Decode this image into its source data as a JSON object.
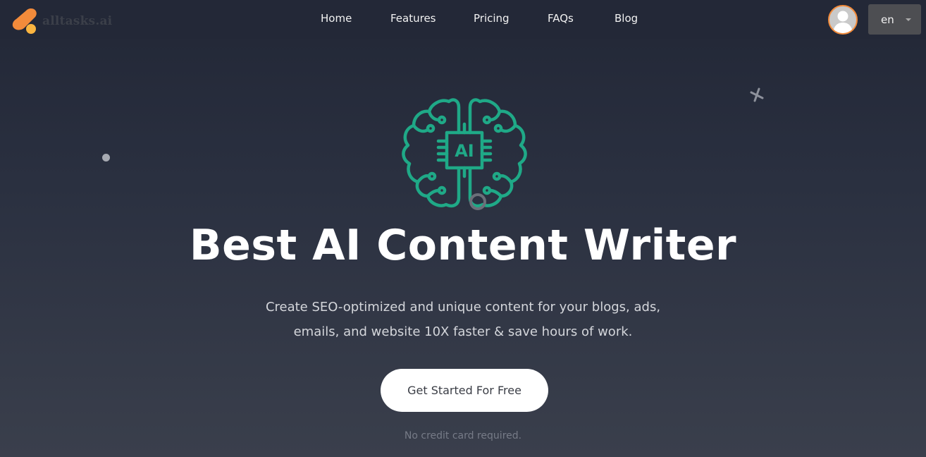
{
  "brand": {
    "name": "alltasks.ai",
    "logo_primary_color": "#f28b3b",
    "logo_secondary_color": "#fbb540"
  },
  "nav": {
    "items": [
      {
        "label": "Home"
      },
      {
        "label": "Features"
      },
      {
        "label": "Pricing"
      },
      {
        "label": "FAQs"
      },
      {
        "label": "Blog"
      }
    ],
    "language": {
      "selected": "en"
    },
    "avatar_icon": "user-avatar-icon"
  },
  "hero": {
    "icon": "ai-brain-chip-icon",
    "icon_label": "AI",
    "icon_color": "#1fa987",
    "title": "Best AI Content Writer",
    "subtitle": "Create SEO-optimized and unique content for your blogs, ads, emails, and website 10X faster & save hours of work.",
    "cta_label": "Get Started For Free",
    "note": "No credit card required."
  }
}
